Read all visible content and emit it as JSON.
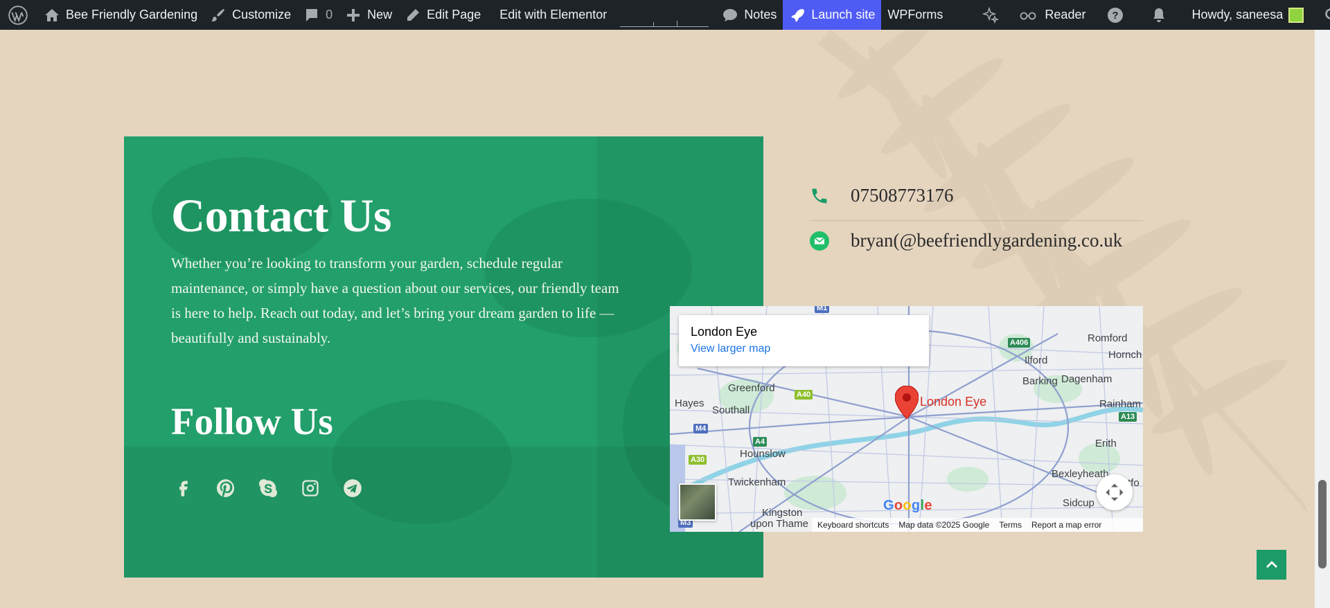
{
  "adminbar": {
    "site_name": "Bee Friendly Gardening",
    "customize": "Customize",
    "comments_count": "0",
    "new_label": "New",
    "edit_page": "Edit Page",
    "edit_elementor": "Edit with Elementor",
    "notes": "Notes",
    "launch_site": "Launch site",
    "wpforms": "WPForms",
    "reader": "Reader",
    "howdy": "Howdy, saneesa"
  },
  "contact": {
    "title": "Contact Us",
    "description": "Whether you’re looking to transform your garden, schedule regular maintenance, or simply have a question about our services, our friendly team is here to help. Reach out today, and let’s bring your dream garden to life — beautifully and sustainably.",
    "follow_title": "Follow Us",
    "socials": [
      "facebook-icon",
      "pinterest-icon",
      "skype-icon",
      "instagram-icon",
      "telegram-icon"
    ],
    "phone": "07508773176",
    "email": "bryan(@beefriendlygardening.co.uk"
  },
  "map": {
    "place_title": "London Eye",
    "view_larger": "View larger map",
    "pin_label": "London Eye",
    "labels": {
      "romford": "Romford",
      "hornchurch": "Hornch",
      "ilford": "Ilford",
      "barking": "Barking",
      "dagenham": "Dagenham",
      "greenford": "Greenford",
      "hayes": "Hayes",
      "southall": "Southall",
      "rainham": "Rainham",
      "erith": "Erith",
      "hounslow": "Hounslow",
      "bexleyheath": "Bexleyheath",
      "dartford": "rtfo",
      "twickenham": "Twickenham",
      "sidcup": "Sidcup",
      "kingston": "Kingston",
      "upon_thames": "upon Thame"
    },
    "roads": {
      "a406": "A406",
      "a40": "A40",
      "m4": "M4",
      "a4": "A4",
      "a30": "A30",
      "a13": "A13",
      "m3": "M3",
      "m1": "M1"
    },
    "google": "Google",
    "footer": {
      "shortcuts": "Keyboard shortcuts",
      "map_data": "Map data ©2025 Google",
      "terms": "Terms",
      "report": "Report a map error"
    }
  },
  "colors": {
    "panel_green": "#229f6a",
    "page_bg": "#e5d5bf",
    "accent_green": "#1c9b68",
    "launch_blue": "#4f5bf5"
  }
}
